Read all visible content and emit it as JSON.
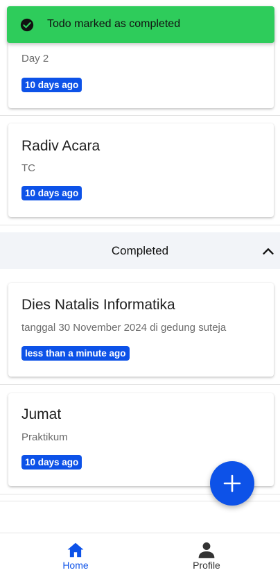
{
  "toast": {
    "message": "Todo marked as completed"
  },
  "pending_todos": [
    {
      "title": "",
      "description": "Day 2",
      "time": "10 days ago"
    },
    {
      "title": "Radiv Acara",
      "description": "TC",
      "time": "10 days ago"
    }
  ],
  "completed_section": {
    "label": "Completed"
  },
  "completed_todos": [
    {
      "title": "Dies Natalis Informatika",
      "description": "tanggal 30 November 2024 di gedung suteja",
      "time": "less than a minute ago"
    },
    {
      "title": "Jumat",
      "description": "Praktikum",
      "time": "10 days ago"
    }
  ],
  "bottom_nav": {
    "items": [
      {
        "label": "Home",
        "icon": "home-icon",
        "active": true
      },
      {
        "label": "Profile",
        "icon": "person-icon",
        "active": false
      }
    ]
  },
  "colors": {
    "accent": "#0d52e8",
    "toast": "#2ecc5b"
  }
}
